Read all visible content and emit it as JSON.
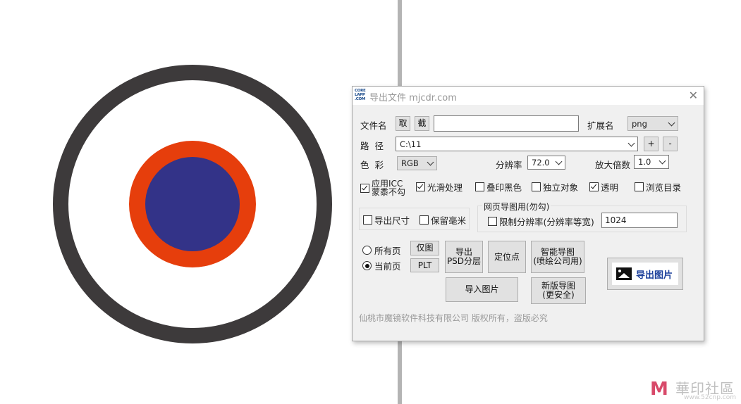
{
  "dialog": {
    "logo_text": "CORE\nLAPP\n.COM",
    "title": "导出文件 mjcdr.com",
    "filename_label": "文件名",
    "btn_get": "取",
    "btn_capture": "截",
    "filename_value": "",
    "ext_label": "扩展名",
    "ext_value": "png",
    "path_label": "路  径",
    "path_value": "C:\\11",
    "btn_plus": "+",
    "btn_minus": "-",
    "color_label": "色  彩",
    "color_value": "RGB",
    "resolution_label": "分辨率",
    "resolution_value": "72.0",
    "zoom_label": "放大倍数",
    "zoom_value": "1.0",
    "options": [
      {
        "label": "应用ICC\n蒙黍不勾",
        "checked": true
      },
      {
        "label": "光滑处理",
        "checked": true
      },
      {
        "label": "叠印黑色",
        "checked": false
      },
      {
        "label": "独立对象",
        "checked": false
      },
      {
        "label": "透明",
        "checked": true
      },
      {
        "label": "浏览目录",
        "checked": false
      }
    ],
    "export_size": {
      "label": "导出尺寸",
      "checked": false
    },
    "keep_mm": {
      "label": "保留毫米",
      "checked": false
    },
    "web_group_title": "网页导图用(勿勾)",
    "limit_resolution": {
      "label": "限制分辨率(分辨率等宽)",
      "checked": false
    },
    "limit_value": "1024",
    "page_all": "所有页",
    "page_current": "当前页",
    "btn_only_graph": "仅图",
    "btn_plt": "PLT",
    "btn_export_psd": "导出\nPSD分层",
    "btn_anchor": "定位点",
    "btn_smart_export": "智能导图\n(喷绘公司用)",
    "btn_import_image": "导入图片",
    "btn_new_export": "新版导图\n(更安全)",
    "btn_export_image": "导出图片",
    "footer": "仙桃市魔镜软件科技有限公司  版权所有，盗版必究",
    "close_symbol": "✕"
  },
  "canvas": {
    "outer_ring_color": "#3d3a3b",
    "orange_ring_color": "#e63e0c",
    "inner_circle_color": "#333388"
  },
  "watermark": {
    "logo": "M",
    "text": "華印社區",
    "url": "www.52cnp.com"
  }
}
